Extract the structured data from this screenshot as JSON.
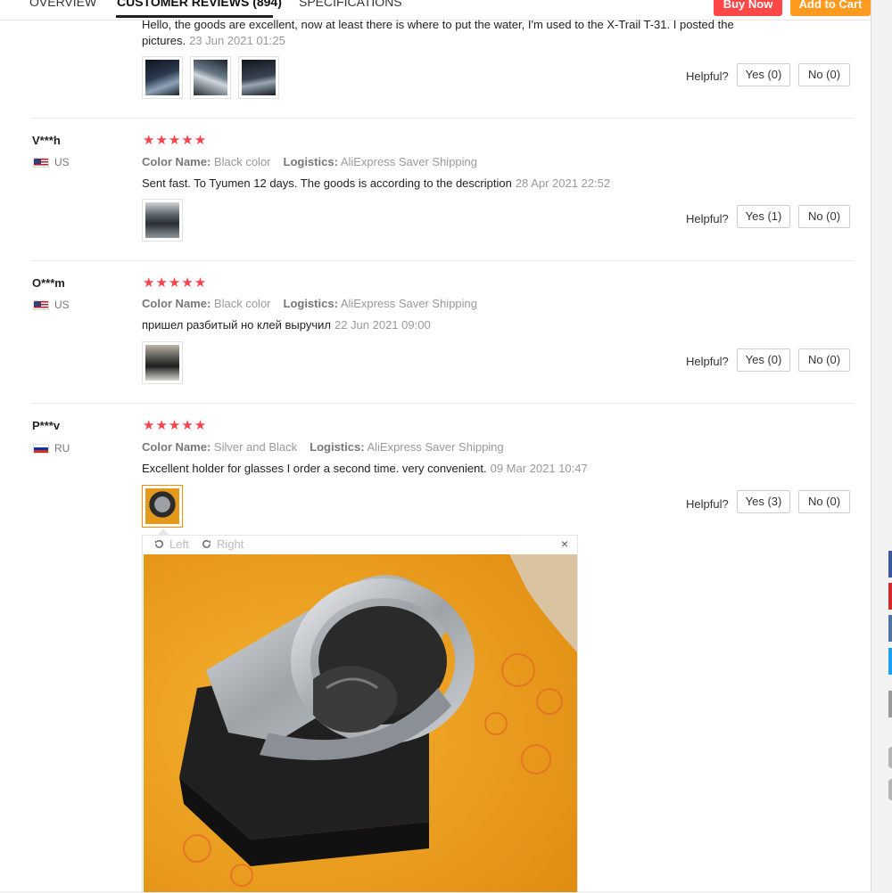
{
  "tabs": {
    "overview": "OVERVIEW",
    "reviews": "CUSTOMER REVIEWS (894)",
    "specs": "SPECIFICATIONS"
  },
  "actions": {
    "buy_now": "Buy Now",
    "add_to_cart": "Add to Cart"
  },
  "helpful_label": "Helpful?",
  "attr_labels": {
    "color": "Color Name:",
    "logistics": "Logistics:"
  },
  "top_review": {
    "text_line1": "Hello, the goods are excellent, now at least there is where to put the water, I'm used to the X-Trail T-31. I posted the",
    "text_line2": "pictures.",
    "date": "23 Jun 2021 01:25",
    "yes": "Yes (0)",
    "no": "No (0)"
  },
  "reviews": [
    {
      "user": "V***h",
      "country": "US",
      "rating": 5,
      "color": "Black color",
      "logistics": "AliExpress Saver Shipping",
      "text": "Sent fast. To Tyumen 12 days. The goods is according to the description",
      "date": "28 Apr 2021 22:52",
      "yes": "Yes (1)",
      "no": "No (0)"
    },
    {
      "user": "O***m",
      "country": "US",
      "rating": 5,
      "color": "Black color",
      "logistics": "AliExpress Saver Shipping",
      "text": "пришел разбитый но клей выручил",
      "date": "22 Jun 2021 09:00",
      "yes": "Yes (0)",
      "no": "No (0)"
    },
    {
      "user": "P***v",
      "country": "RU",
      "rating": 5,
      "color": "Silver and Black",
      "logistics": "AliExpress Saver Shipping",
      "text": "Excellent holder for glasses I order a second time. very convenient.",
      "date": "09 Mar 2021 10:47",
      "yes": "Yes (3)",
      "no": "No (0)"
    }
  ],
  "viewer": {
    "left": "Left",
    "right": "Right",
    "close": "×"
  },
  "stars_glyph": "★★★★★",
  "colors": {
    "star": "#f5444c",
    "buy": "#ff4747",
    "cart": "#ff9a1f",
    "photo_bg": "#f5a623"
  }
}
